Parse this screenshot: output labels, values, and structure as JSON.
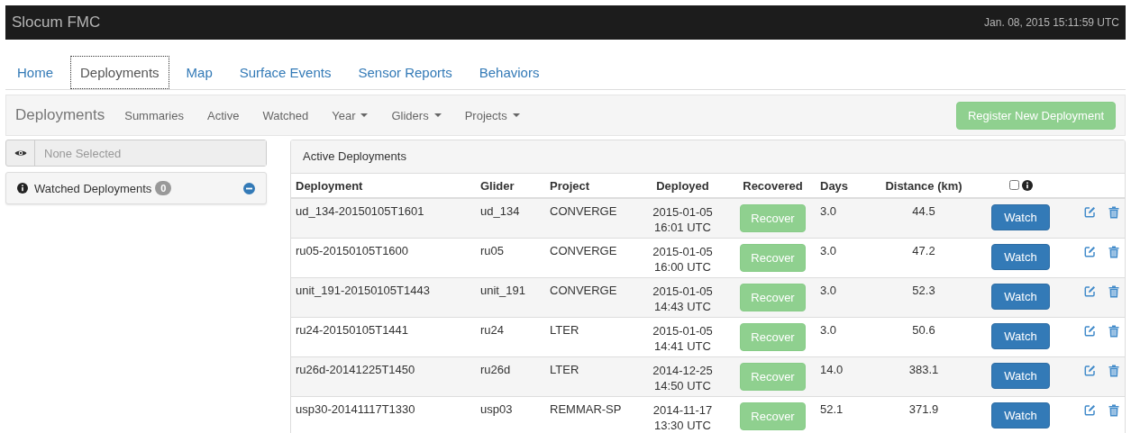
{
  "navbar": {
    "brand": "Slocum FMC",
    "clock": "Jan. 08, 2015 15:11:59 UTC"
  },
  "tabs": [
    {
      "label": "Home",
      "selected": false
    },
    {
      "label": "Deployments",
      "selected": true
    },
    {
      "label": "Map",
      "selected": false
    },
    {
      "label": "Surface Events",
      "selected": false
    },
    {
      "label": "Sensor Reports",
      "selected": false
    },
    {
      "label": "Behaviors",
      "selected": false
    }
  ],
  "subnav": {
    "title": "Deployments",
    "items": [
      {
        "label": "Summaries",
        "dropdown": false
      },
      {
        "label": "Active",
        "dropdown": false
      },
      {
        "label": "Watched",
        "dropdown": false
      },
      {
        "label": "Year",
        "dropdown": true
      },
      {
        "label": "Gliders",
        "dropdown": true
      },
      {
        "label": "Projects",
        "dropdown": true
      }
    ],
    "register_button": "Register New Deployment"
  },
  "sidebar": {
    "search": {
      "placeholder": "None Selected"
    },
    "watched": {
      "label": "Watched Deployments",
      "count": "0"
    }
  },
  "table": {
    "title": "Active Deployments",
    "select_all_checked": false,
    "columns": [
      "Deployment",
      "Glider",
      "Project",
      "Deployed",
      "Recovered",
      "Days",
      "Distance (km)"
    ],
    "rows": [
      {
        "deployment": "ud_134-20150105T1601",
        "glider": "ud_134",
        "project": "CONVERGE",
        "date": "2015-01-05",
        "time": "16:01 UTC",
        "recover": "Recover",
        "days": "3.0",
        "distance": "44.5",
        "watch": "Watch"
      },
      {
        "deployment": "ru05-20150105T1600",
        "glider": "ru05",
        "project": "CONVERGE",
        "date": "2015-01-05",
        "time": "16:00 UTC",
        "recover": "Recover",
        "days": "3.0",
        "distance": "47.2",
        "watch": "Watch"
      },
      {
        "deployment": "unit_191-20150105T1443",
        "glider": "unit_191",
        "project": "CONVERGE",
        "date": "2015-01-05",
        "time": "14:43 UTC",
        "recover": "Recover",
        "days": "3.0",
        "distance": "52.3",
        "watch": "Watch"
      },
      {
        "deployment": "ru24-20150105T1441",
        "glider": "ru24",
        "project": "LTER",
        "date": "2015-01-05",
        "time": "14:41 UTC",
        "recover": "Recover",
        "days": "3.0",
        "distance": "50.6",
        "watch": "Watch"
      },
      {
        "deployment": "ru26d-20141225T1450",
        "glider": "ru26d",
        "project": "LTER",
        "date": "2014-12-25",
        "time": "14:50 UTC",
        "recover": "Recover",
        "days": "14.0",
        "distance": "383.1",
        "watch": "Watch"
      },
      {
        "deployment": "usp30-20141117T1330",
        "glider": "usp03",
        "project": "REMMAR-SP",
        "date": "2014-11-17",
        "time": "13:30 UTC",
        "recover": "Recover",
        "days": "52.1",
        "distance": "371.9",
        "watch": "Watch"
      }
    ]
  }
}
